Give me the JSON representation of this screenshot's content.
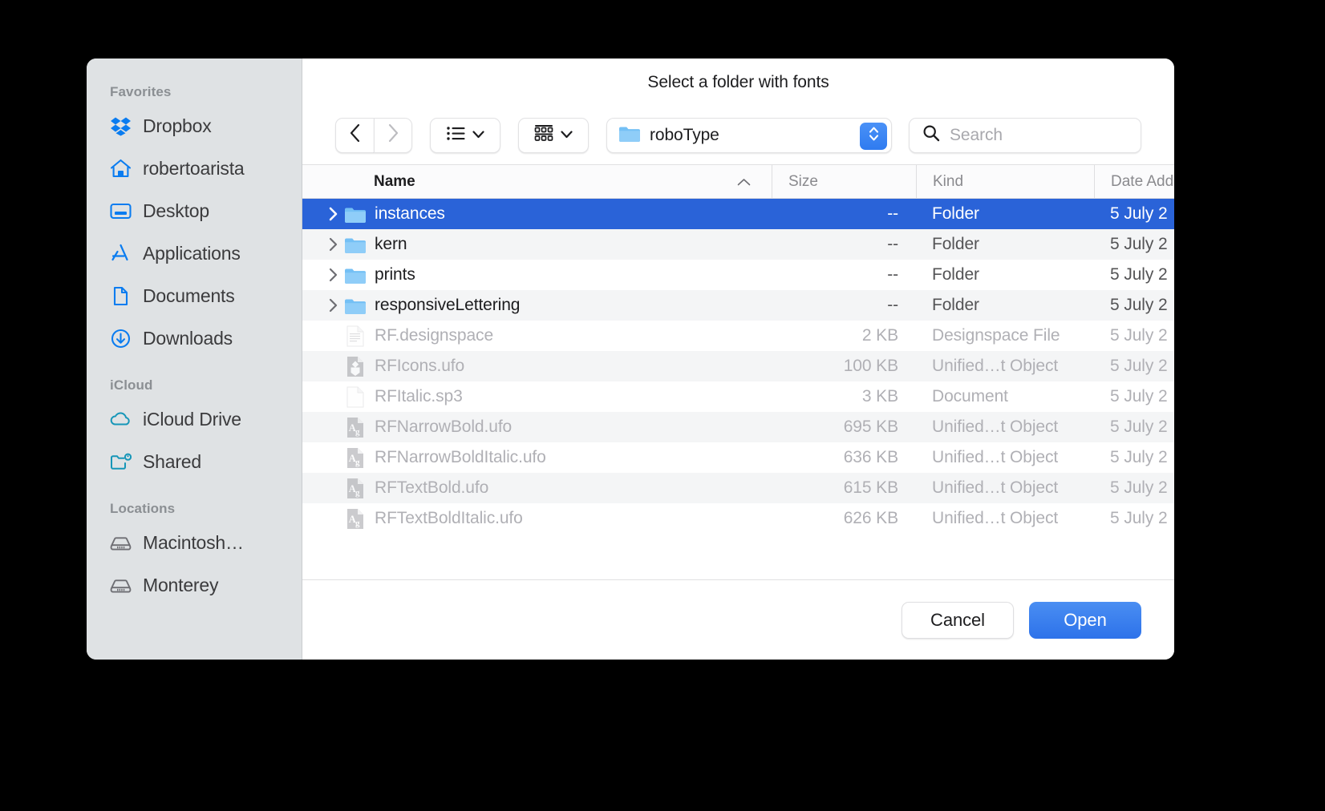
{
  "dialog": {
    "title": "Select a folder with fonts"
  },
  "sidebar": {
    "groups": [
      {
        "title": "Favorites",
        "items": [
          {
            "label": "Dropbox",
            "icon": "dropbox-icon"
          },
          {
            "label": "robertoarista",
            "icon": "home-icon"
          },
          {
            "label": "Desktop",
            "icon": "desktop-icon"
          },
          {
            "label": "Applications",
            "icon": "applications-icon"
          },
          {
            "label": "Documents",
            "icon": "document-icon"
          },
          {
            "label": "Downloads",
            "icon": "downloads-icon"
          }
        ]
      },
      {
        "title": "iCloud",
        "items": [
          {
            "label": "iCloud Drive",
            "icon": "cloud-icon"
          },
          {
            "label": "Shared",
            "icon": "shared-folder-icon"
          }
        ]
      },
      {
        "title": "Locations",
        "items": [
          {
            "label": "Macintosh…",
            "icon": "harddisk-icon"
          },
          {
            "label": "Monterey",
            "icon": "harddisk-icon"
          }
        ]
      }
    ]
  },
  "toolbar": {
    "back_icon": "chevron-left-icon",
    "forward_icon": "chevron-right-icon",
    "view_icon": "list-view-icon",
    "view_chevron": "chevron-down-icon",
    "group_icon": "grid-view-icon",
    "group_chevron": "chevron-down-icon",
    "path_icon": "folder-icon",
    "path_label": "roboType",
    "stepper_icon": "up-down-stepper-icon",
    "search_icon": "search-icon",
    "search_value": "",
    "search_placeholder": "Search"
  },
  "table": {
    "columns": [
      {
        "key": "name",
        "label": "Name",
        "sorted": true,
        "sort_icon": "chevron-up-icon"
      },
      {
        "key": "size",
        "label": "Size"
      },
      {
        "key": "kind",
        "label": "Kind"
      },
      {
        "key": "date",
        "label": "Date Add"
      }
    ],
    "rows": [
      {
        "name": "instances",
        "size": "--",
        "kind": "Folder",
        "date": "5 July 2",
        "icon": "folder-icon",
        "expandable": true,
        "selected": true,
        "dimmed": false
      },
      {
        "name": "kern",
        "size": "--",
        "kind": "Folder",
        "date": "5 July 2",
        "icon": "folder-icon",
        "expandable": true,
        "selected": false,
        "dimmed": false
      },
      {
        "name": "prints",
        "size": "--",
        "kind": "Folder",
        "date": "5 July 2",
        "icon": "folder-icon",
        "expandable": true,
        "selected": false,
        "dimmed": false
      },
      {
        "name": "responsiveLettering",
        "size": "--",
        "kind": "Folder",
        "date": "5 July 2",
        "icon": "folder-icon",
        "expandable": true,
        "selected": false,
        "dimmed": false
      },
      {
        "name": "RF.designspace",
        "size": "2 KB",
        "kind": "Designspace File",
        "date": "5 July 2",
        "icon": "text-document-icon",
        "expandable": false,
        "selected": false,
        "dimmed": true
      },
      {
        "name": "RFIcons.ufo",
        "size": "100 KB",
        "kind": "Unified…t Object",
        "date": "5 July 2",
        "icon": "ufo-icons-icon",
        "expandable": false,
        "selected": false,
        "dimmed": true
      },
      {
        "name": "RFItalic.sp3",
        "size": "3 KB",
        "kind": "Document",
        "date": "5 July 2",
        "icon": "blank-document-icon",
        "expandable": false,
        "selected": false,
        "dimmed": true
      },
      {
        "name": "RFNarrowBold.ufo",
        "size": "695 KB",
        "kind": "Unified…t Object",
        "date": "5 July 2",
        "icon": "ufo-font-icon",
        "expandable": false,
        "selected": false,
        "dimmed": true
      },
      {
        "name": "RFNarrowBoldItalic.ufo",
        "size": "636 KB",
        "kind": "Unified…t Object",
        "date": "5 July 2",
        "icon": "ufo-font-icon",
        "expandable": false,
        "selected": false,
        "dimmed": true
      },
      {
        "name": "RFTextBold.ufo",
        "size": "615 KB",
        "kind": "Unified…t Object",
        "date": "5 July 2",
        "icon": "ufo-font-icon",
        "expandable": false,
        "selected": false,
        "dimmed": true
      },
      {
        "name": "RFTextBoldItalic.ufo",
        "size": "626 KB",
        "kind": "Unified…t Object",
        "date": "5 July 2",
        "icon": "ufo-font-icon",
        "expandable": false,
        "selected": false,
        "dimmed": true
      }
    ]
  },
  "footer": {
    "cancel_label": "Cancel",
    "open_label": "Open"
  },
  "colors": {
    "selection_blue": "#2a63d8",
    "accent_blue": "#2d72ea",
    "sidebar_bg": "#dfe2e4",
    "icon_blue": "#0a7cf0",
    "icon_teal": "#1696b8"
  }
}
